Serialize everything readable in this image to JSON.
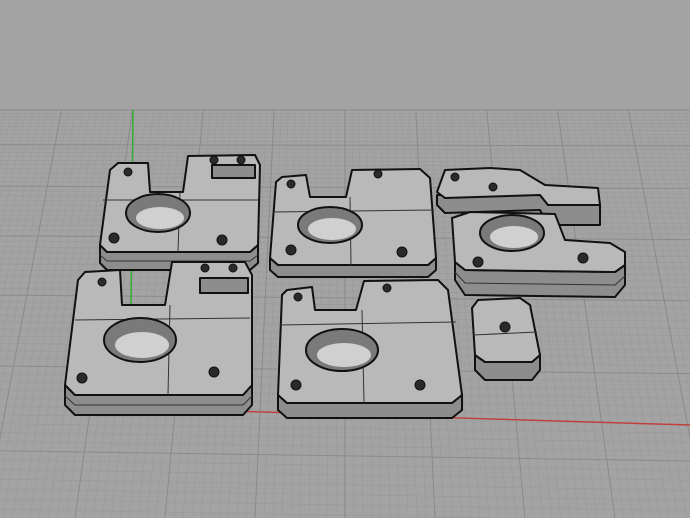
{
  "viewport": {
    "view": "perspective",
    "colors": {
      "background": "#a3a3a3",
      "grid_minor": "#999999",
      "grid_major": "#8a8a8a",
      "x_axis": "#c04040",
      "y_axis": "#30b030",
      "part_top": "#b9b9b9",
      "part_side": "#8d8d8d"
    },
    "parts": [
      "extruder-base-1",
      "extruder-base-2",
      "idler-arm",
      "extruder-base-3",
      "extruder-base-4",
      "spacer-block"
    ]
  }
}
